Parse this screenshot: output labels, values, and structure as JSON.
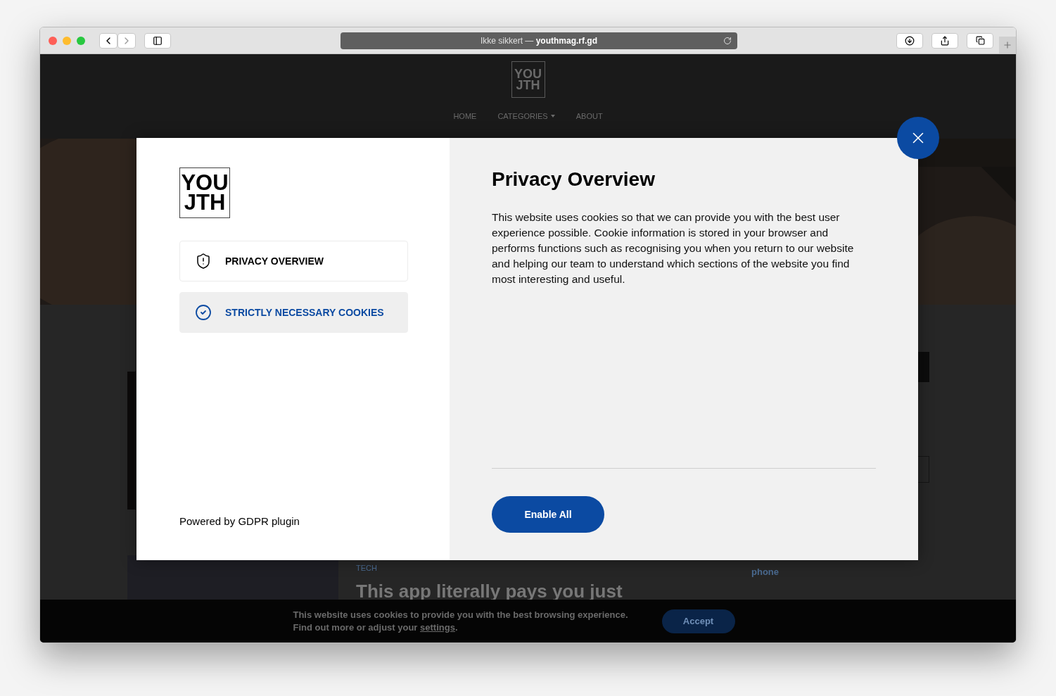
{
  "browser": {
    "address_prefix": "Ikke sikkert —",
    "address_host": "youthmag.rf.gd"
  },
  "page": {
    "logo": [
      "YOU",
      "JTH"
    ],
    "nav": [
      {
        "label": "HOME",
        "dropdown": false
      },
      {
        "label": "CATEGORIES",
        "dropdown": true
      },
      {
        "label": "ABOUT",
        "dropdown": false
      }
    ],
    "article": {
      "category": "TECH",
      "title": "This app literally pays you just"
    },
    "side_text": "phone",
    "cookie_bar": {
      "text_1": "This website uses cookies to provide you with the best browsing experience.",
      "text_2": "Find out more or adjust your",
      "link": "settings",
      "text_end": ".",
      "button": "Accept"
    }
  },
  "modal": {
    "logo": [
      "YOU",
      "JTH"
    ],
    "tabs": [
      {
        "label": "PRIVACY OVERVIEW",
        "selected": true
      },
      {
        "label": "STRICTLY NECESSARY COOKIES",
        "selected": false
      }
    ],
    "powered_by": "Powered by GDPR plugin",
    "title": "Privacy Overview",
    "body": "This website uses cookies so that we can provide you with the best user experience possible. Cookie information is stored in your browser and performs functions such as recognising you when you return to our website and helping our team to understand which sections of the website you find most interesting and useful.",
    "button": "Enable All"
  }
}
